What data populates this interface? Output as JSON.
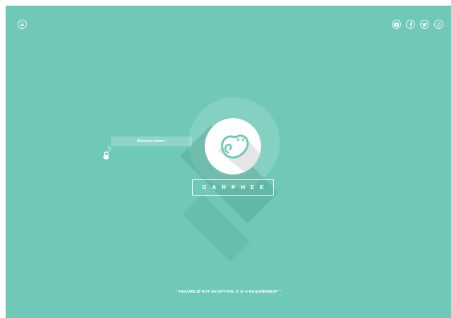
{
  "brand": {
    "name": "GARPHEE"
  },
  "welcome": {
    "message": "Welcome visitor !"
  },
  "quote": {
    "text": "\" FAILURE IS NOT AN OPTION, IT IS A REQUIREMENT \""
  },
  "nav": {
    "menu_icon": "menu-icon"
  },
  "social": {
    "icons": [
      "youtube-icon",
      "facebook-icon",
      "twitter-icon",
      "chat-icon"
    ]
  },
  "colors": {
    "background": "#70c9b8",
    "foreground": "#ffffff"
  }
}
